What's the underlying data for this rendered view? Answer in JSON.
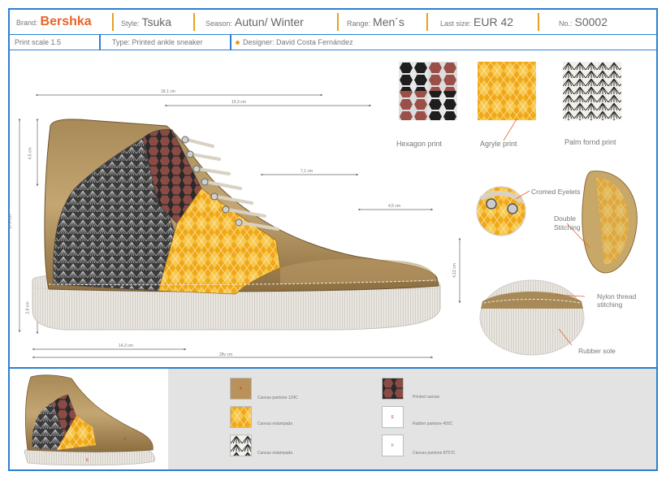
{
  "header": {
    "brand_label": "Brand:",
    "brand_value": "Bershka",
    "style_label": "Style:",
    "style_value": "Tsuka",
    "season_label": "Season:",
    "season_value": "Autun/ Winter",
    "range_label": "Range:",
    "range_value": "Men´s",
    "lastsize_label": "Last size:",
    "lastsize_value": "EUR 42",
    "no_label": "No.:",
    "no_value": "S0002"
  },
  "subheader": {
    "print_scale": "Print scale 1.5",
    "type": "Type: Printed ankle sneaker",
    "designer": "Designer: David Costa Fernández"
  },
  "dimensions": {
    "d1": "18,1 cm",
    "d2": "10,3 cm",
    "d3": "7,1 cm",
    "d4": "4,5 cm",
    "d5": "14,3 cm",
    "d6": "28v cm",
    "d7": "17,4 cm",
    "d8": "4,5 cm",
    "d9": "2,8 cm",
    "d10": "4,12 cm"
  },
  "prints": {
    "hexagon": "Hexagon print",
    "argyle": "Agryle print",
    "palm": "Palm fornd print"
  },
  "callouts": {
    "eyelets": "Cromed Eyelets",
    "stitching": "Double\nStitching",
    "nylon": "Nylon thread\nstitching",
    "sole": "Rubber sole"
  },
  "materials": [
    {
      "code": "A",
      "label": "Canvas pantone 124C",
      "color": "#b8925a"
    },
    {
      "code": "",
      "label": "Canvas estampada",
      "color": "#f2b01e"
    },
    {
      "code": "",
      "label": "Canvas estampada",
      "color": "#222"
    },
    {
      "code": "",
      "label": "Printed canvas",
      "color": "#444"
    },
    {
      "code": "E",
      "label": "Rubber pantone 405C",
      "color": "#ffffff"
    },
    {
      "code": "F",
      "label": "Canvas pantone 8757C",
      "color": "#ffffff"
    }
  ],
  "colors": {
    "accent_blue": "#2b7fd0",
    "accent_orange": "#e8a020",
    "brand": "#e8642a"
  }
}
